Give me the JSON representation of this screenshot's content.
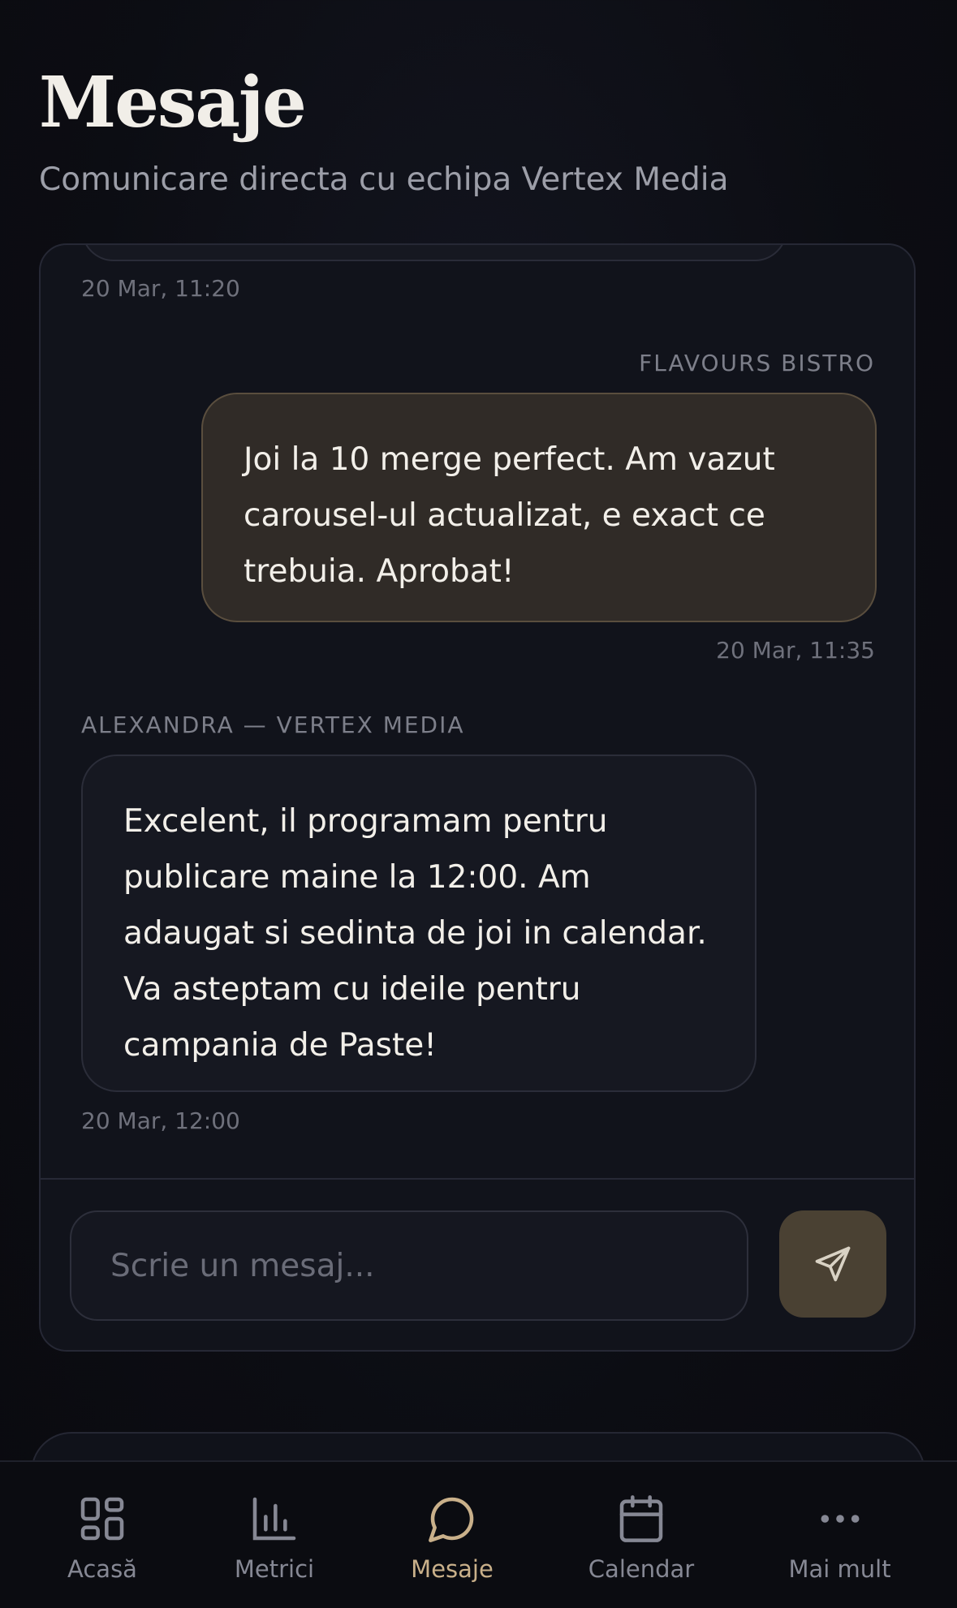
{
  "header": {
    "title": "Mesaje",
    "subtitle": "Comunicare directa cu echipa Vertex Media"
  },
  "chat": {
    "messages": [
      {
        "direction": "incoming",
        "sender": "",
        "text": "",
        "timestamp": "20 Mar, 11:20"
      },
      {
        "direction": "outgoing",
        "sender": "FLAVOURS BISTRO",
        "text": "Joi la 10 merge perfect. Am vazut carousel-ul actualizat, e exact ce trebuia. Aprobat!",
        "timestamp": "20 Mar, 11:35"
      },
      {
        "direction": "incoming",
        "sender": "ALEXANDRA — VERTEX MEDIA",
        "text": "Excelent, il programam pentru publicare maine la 12:00. Am adaugat si sedinta de joi in calendar. Va asteptam cu ideile pentru campania de Paste!",
        "timestamp": "20 Mar, 12:00"
      }
    ]
  },
  "composer": {
    "value": "",
    "placeholder": "Scrie un mesaj...",
    "send_icon": "send-icon"
  },
  "nav": {
    "items": [
      {
        "label": "Acasă",
        "icon": "grid-icon",
        "active": false
      },
      {
        "label": "Metrici",
        "icon": "bar-chart-icon",
        "active": false
      },
      {
        "label": "Mesaje",
        "icon": "chat-bubble-icon",
        "active": true
      },
      {
        "label": "Calendar",
        "icon": "calendar-icon",
        "active": false
      },
      {
        "label": "Mai mult",
        "icon": "more-icon",
        "active": false
      }
    ]
  },
  "colors": {
    "accent": "#c9b08a",
    "background": "#0b0c11",
    "card": "#11131b",
    "outgoing_bubble": "#302b27",
    "send_button": "#4a4133"
  }
}
